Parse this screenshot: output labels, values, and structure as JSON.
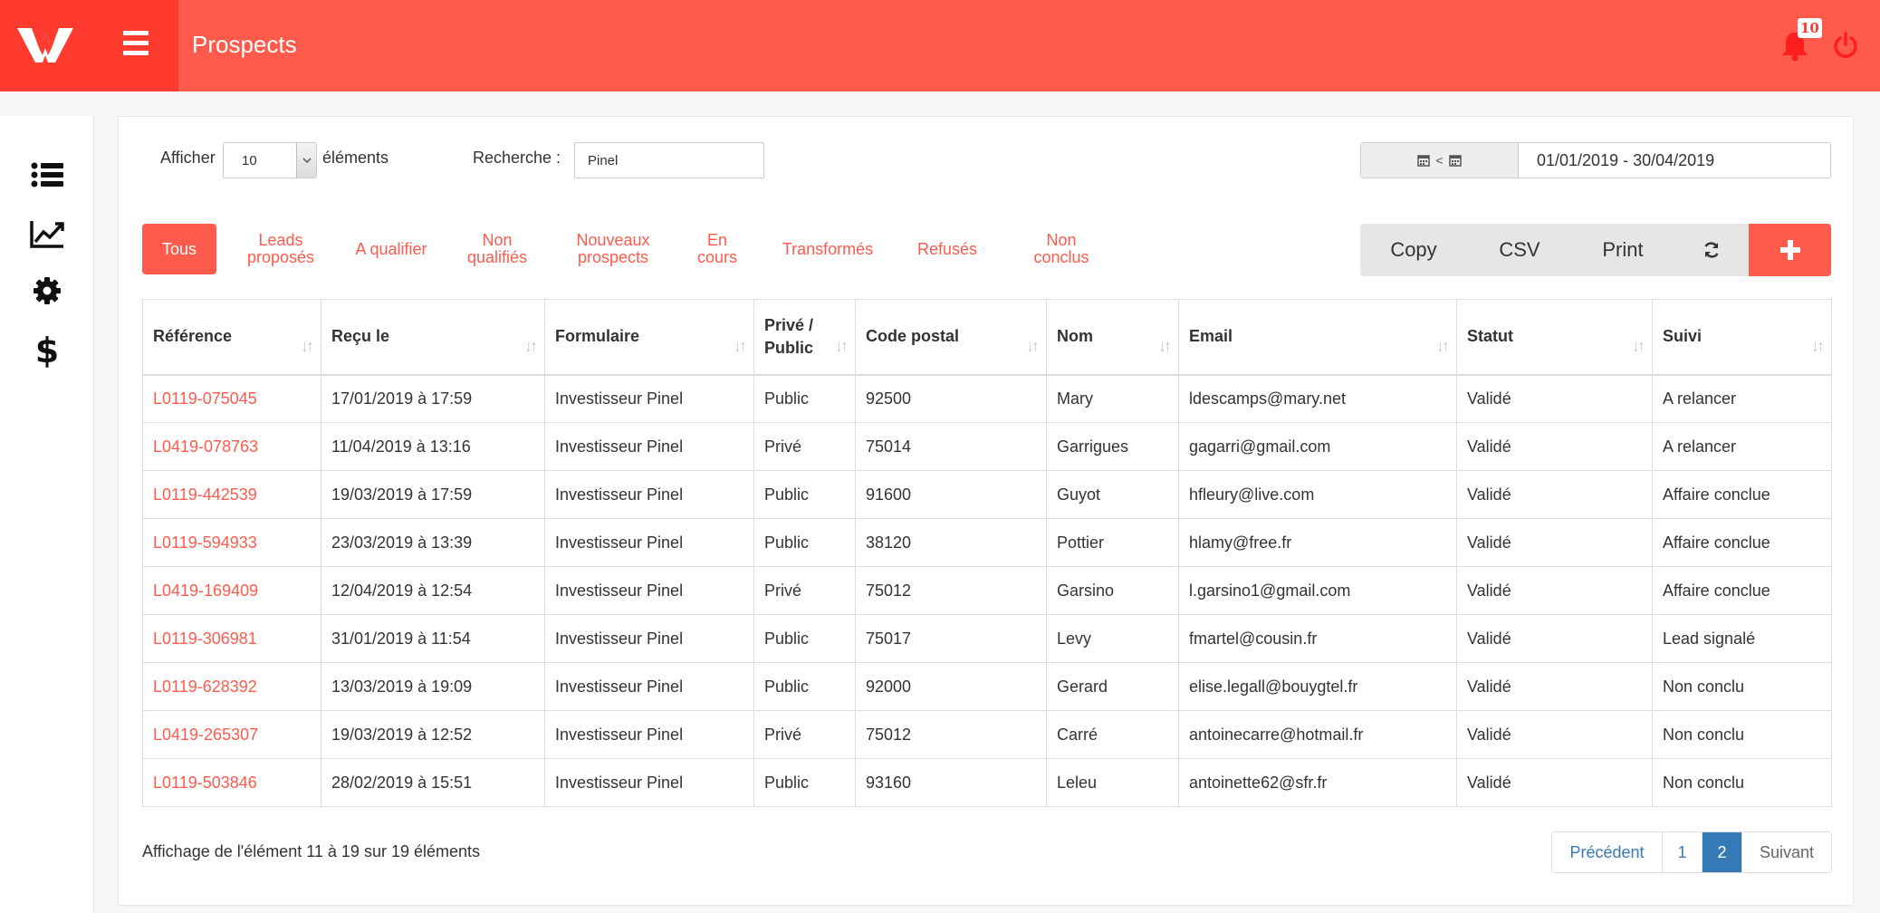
{
  "header": {
    "title": "Prospects",
    "notification_count": "10",
    "accent_color": "#ff5b4d"
  },
  "sidebar": {
    "items": [
      {
        "icon": "list-icon"
      },
      {
        "icon": "chart-line-icon"
      },
      {
        "icon": "gear-icon"
      },
      {
        "icon": "dollar-icon"
      }
    ]
  },
  "controls": {
    "show_label": "Afficher",
    "show_value": "10",
    "show_suffix": "éléments",
    "search_label": "Recherche :",
    "search_value": "Pinel",
    "date_separator": "<",
    "date_range": "01/01/2019 - 30/04/2019"
  },
  "filters": [
    {
      "label": "Tous",
      "active": true
    },
    {
      "label": "Leads proposés"
    },
    {
      "label": "A qualifier"
    },
    {
      "label": "Non qualifiés"
    },
    {
      "label": "Nouveaux prospects"
    },
    {
      "label": "En cours"
    },
    {
      "label": "Transformés"
    },
    {
      "label": "Refusés"
    },
    {
      "label": "Non conclus"
    }
  ],
  "actions": {
    "copy": "Copy",
    "csv": "CSV",
    "print": "Print"
  },
  "table": {
    "columns": [
      "Référence",
      "Reçu le",
      "Formulaire",
      "Privé / Public",
      "Code postal",
      "Nom",
      "Email",
      "Statut",
      "Suivi"
    ],
    "rows": [
      [
        "L0119-075045",
        "17/01/2019 à 17:59",
        "Investisseur Pinel",
        "Public",
        "92500",
        "Mary",
        "ldescamps@mary.net",
        "Validé",
        "A relancer"
      ],
      [
        "L0419-078763",
        "11/04/2019 à 13:16",
        "Investisseur Pinel",
        "Privé",
        "75014",
        "Garrigues",
        "gagarri@gmail.com",
        "Validé",
        "A relancer"
      ],
      [
        "L0119-442539",
        "19/03/2019 à 17:59",
        "Investisseur Pinel",
        "Public",
        "91600",
        "Guyot",
        "hfleury@live.com",
        "Validé",
        "Affaire conclue"
      ],
      [
        "L0119-594933",
        "23/03/2019 à 13:39",
        "Investisseur Pinel",
        "Public",
        "38120",
        "Pottier",
        "hlamy@free.fr",
        "Validé",
        "Affaire conclue"
      ],
      [
        "L0419-169409",
        "12/04/2019 à 12:54",
        "Investisseur Pinel",
        "Privé",
        "75012",
        "Garsino",
        "l.garsino1@gmail.com",
        "Validé",
        "Affaire conclue"
      ],
      [
        "L0119-306981",
        "31/01/2019 à 11:54",
        "Investisseur Pinel",
        "Public",
        "75017",
        "Levy",
        "fmartel@cousin.fr",
        "Validé",
        "Lead signalé"
      ],
      [
        "L0119-628392",
        "13/03/2019 à 19:09",
        "Investisseur Pinel",
        "Public",
        "92000",
        "Gerard",
        "elise.legall@bouygtel.fr",
        "Validé",
        "Non conclu"
      ],
      [
        "L0419-265307",
        "19/03/2019 à 12:52",
        "Investisseur Pinel",
        "Privé",
        "75012",
        "Carré",
        "antoinecarre@hotmail.fr",
        "Validé",
        "Non conclu"
      ],
      [
        "L0119-503846",
        "28/02/2019 à 15:51",
        "Investisseur Pinel",
        "Public",
        "93160",
        "Leleu",
        "antoinette62@sfr.fr",
        "Validé",
        "Non conclu"
      ]
    ]
  },
  "footer": {
    "info": "Affichage de l'élément 11 à 19 sur 19 éléments",
    "pagination": [
      {
        "label": "Précédent"
      },
      {
        "label": "1"
      },
      {
        "label": "2",
        "active": true
      },
      {
        "label": "Suivant"
      }
    ]
  }
}
